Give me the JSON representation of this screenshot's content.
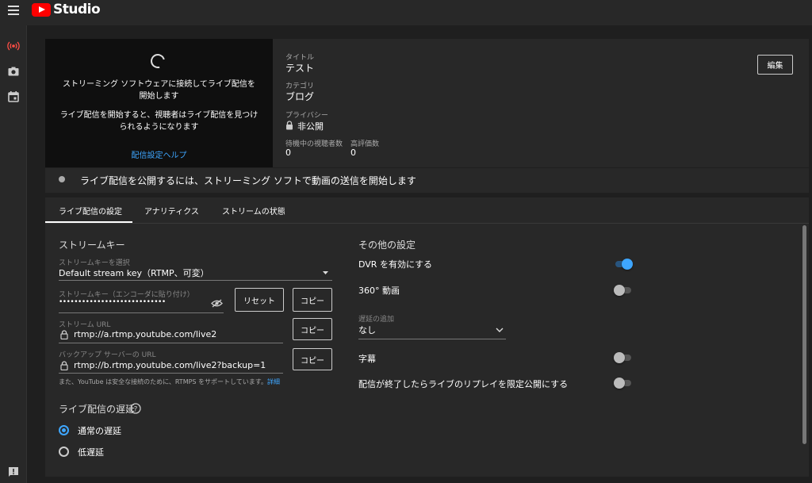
{
  "header": {
    "app_name": "Studio"
  },
  "sidebar": {
    "items": [
      {
        "icon": "live-broadcast-icon",
        "active": true
      },
      {
        "icon": "camera-icon",
        "active": false
      },
      {
        "icon": "calendar-icon",
        "active": false
      }
    ],
    "feedback_icon": "feedback-icon"
  },
  "preview": {
    "message_1": "ストリーミング ソフトウェアに接続してライブ配信を開始します",
    "message_2": "ライブ配信を開始すると、視聴者はライブ配信を見つけられるようになります",
    "help_link": "配信設定ヘルプ"
  },
  "details": {
    "title_label": "タイトル",
    "title_value": "テスト",
    "category_label": "カテゴリ",
    "category_value": "ブログ",
    "privacy_label": "プライバシー",
    "privacy_value": "非公開",
    "waiting_viewers_label": "待機中の視聴者数",
    "waiting_viewers_value": "0",
    "likes_label": "高評価数",
    "likes_value": "0",
    "edit_button": "編集"
  },
  "status": {
    "message": "ライブ配信を公開するには、ストリーミング ソフトで動画の送信を開始します"
  },
  "tabs": [
    {
      "label": "ライブ配信の設定",
      "active": true
    },
    {
      "label": "アナリティクス",
      "active": false
    },
    {
      "label": "ストリームの状態",
      "active": false
    }
  ],
  "stream_key": {
    "section_title": "ストリームキー",
    "select_label": "ストリームキーを選択",
    "select_value": "Default stream key（RTMP、可変）",
    "key_label": "ストリームキー（エンコーダに貼り付け）",
    "key_value": "••••••••••••••••••••••••••••",
    "reset_button": "リセット",
    "copy_button": "コピー",
    "url_label": "ストリーム URL",
    "url_value": "rtmp://a.rtmp.youtube.com/live2",
    "backup_label": "バックアップ サーバーの URL",
    "backup_value": "rtmp://b.rtmp.youtube.com/live2?backup=1",
    "rtmps_note": "また、YouTube は安全な接続のために、RTMPS をサポートしています。",
    "rtmps_link": "詳細"
  },
  "latency": {
    "section_title": "ライブ配信の遅延",
    "options": [
      {
        "label": "通常の遅延",
        "selected": true
      },
      {
        "label": "低遅延",
        "selected": false
      }
    ]
  },
  "other_settings": {
    "section_title": "その他の設定",
    "dvr_label": "DVR を有効にする",
    "dvr_on": true,
    "vr360_label": "360° 動画",
    "vr360_on": false,
    "delay_label": "遅延の追加",
    "delay_value": "なし",
    "captions_label": "字幕",
    "captions_on": false,
    "replay_label": "配信が終了したらライブのリプレイを限定公開にする",
    "replay_on": false
  },
  "colors": {
    "accent": "#3ea6ff",
    "brand": "#ff0000",
    "active_icon": "#ff4e45"
  }
}
